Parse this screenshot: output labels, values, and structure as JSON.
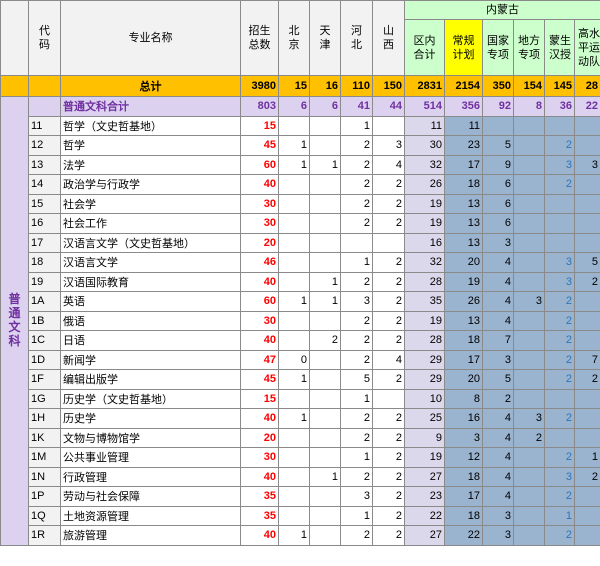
{
  "headers": {
    "code": "代码",
    "name": "专业名称",
    "total_plan": "招生总数",
    "beijing": "北京",
    "tianjin": "天津",
    "hebei": "河北",
    "shanxi": "山西",
    "neimenggu": "内蒙古",
    "qu_nei": "区内合计",
    "changgui": "常规计划",
    "guojia": "国家专项",
    "difang": "地方专项",
    "mengsheng": "蒙生汉授",
    "gaoshui": "高水平运动队"
  },
  "total_row": {
    "label": "总计",
    "values": [
      "3980",
      "15",
      "16",
      "110",
      "150",
      "2831",
      "2154",
      "350",
      "154",
      "145",
      "28"
    ]
  },
  "group": {
    "label": "普通文科",
    "subtotal_label": "普通文科合计",
    "subtotal_values": [
      "803",
      "6",
      "6",
      "41",
      "44",
      "514",
      "356",
      "92",
      "8",
      "36",
      "22"
    ]
  },
  "rows": [
    {
      "code": "11",
      "name": "哲学（文史哲基地）",
      "v": [
        "15",
        "",
        "",
        "1",
        "",
        "11",
        "11",
        "",
        "",
        "",
        ""
      ]
    },
    {
      "code": "12",
      "name": "哲学",
      "v": [
        "45",
        "1",
        "",
        "2",
        "3",
        "30",
        "23",
        "5",
        "",
        "2",
        ""
      ]
    },
    {
      "code": "13",
      "name": "法学",
      "v": [
        "60",
        "1",
        "1",
        "2",
        "4",
        "32",
        "17",
        "9",
        "",
        "3",
        "3"
      ]
    },
    {
      "code": "14",
      "name": "政治学与行政学",
      "v": [
        "40",
        "",
        "",
        "2",
        "2",
        "26",
        "18",
        "6",
        "",
        "2",
        ""
      ]
    },
    {
      "code": "15",
      "name": "社会学",
      "v": [
        "30",
        "",
        "",
        "2",
        "2",
        "19",
        "13",
        "6",
        "",
        "",
        ""
      ]
    },
    {
      "code": "16",
      "name": "社会工作",
      "v": [
        "30",
        "",
        "",
        "2",
        "2",
        "19",
        "13",
        "6",
        "",
        "",
        ""
      ]
    },
    {
      "code": "17",
      "name": "汉语言文学（文史哲基地）",
      "v": [
        "20",
        "",
        "",
        "",
        "",
        "16",
        "13",
        "3",
        "",
        "",
        ""
      ]
    },
    {
      "code": "18",
      "name": "汉语言文学",
      "v": [
        "46",
        "",
        "",
        "1",
        "2",
        "32",
        "20",
        "4",
        "",
        "3",
        "5"
      ]
    },
    {
      "code": "19",
      "name": "汉语国际教育",
      "v": [
        "40",
        "",
        "1",
        "2",
        "2",
        "28",
        "19",
        "4",
        "",
        "3",
        "2"
      ]
    },
    {
      "code": "1A",
      "name": "英语",
      "v": [
        "60",
        "1",
        "1",
        "3",
        "2",
        "35",
        "26",
        "4",
        "3",
        "2",
        ""
      ]
    },
    {
      "code": "1B",
      "name": "俄语",
      "v": [
        "30",
        "",
        "",
        "2",
        "2",
        "19",
        "13",
        "4",
        "",
        "2",
        ""
      ]
    },
    {
      "code": "1C",
      "name": "日语",
      "v": [
        "40",
        "",
        "2",
        "2",
        "2",
        "28",
        "18",
        "7",
        "",
        "2",
        ""
      ]
    },
    {
      "code": "1D",
      "name": "新闻学",
      "v": [
        "47",
        "0",
        "",
        "2",
        "4",
        "29",
        "17",
        "3",
        "",
        "2",
        "7"
      ]
    },
    {
      "code": "1F",
      "name": "编辑出版学",
      "v": [
        "45",
        "1",
        "",
        "5",
        "2",
        "29",
        "20",
        "5",
        "",
        "2",
        "2"
      ]
    },
    {
      "code": "1G",
      "name": "历史学（文史哲基地）",
      "v": [
        "15",
        "",
        "",
        "1",
        "",
        "10",
        "8",
        "2",
        "",
        "",
        ""
      ]
    },
    {
      "code": "1H",
      "name": "历史学",
      "v": [
        "40",
        "1",
        "",
        "2",
        "2",
        "25",
        "16",
        "4",
        "3",
        "2",
        ""
      ]
    },
    {
      "code": "1K",
      "name": "文物与博物馆学",
      "v": [
        "20",
        "",
        "",
        "2",
        "2",
        "9",
        "3",
        "4",
        "2",
        "",
        ""
      ]
    },
    {
      "code": "1M",
      "name": "公共事业管理",
      "v": [
        "30",
        "",
        "",
        "1",
        "2",
        "19",
        "12",
        "4",
        "",
        "2",
        "1"
      ]
    },
    {
      "code": "1N",
      "name": "行政管理",
      "v": [
        "40",
        "",
        "1",
        "2",
        "2",
        "27",
        "18",
        "4",
        "",
        "3",
        "2"
      ]
    },
    {
      "code": "1P",
      "name": "劳动与社会保障",
      "v": [
        "35",
        "",
        "",
        "3",
        "2",
        "23",
        "17",
        "4",
        "",
        "2",
        ""
      ]
    },
    {
      "code": "1Q",
      "name": "土地资源管理",
      "v": [
        "35",
        "",
        "",
        "1",
        "2",
        "22",
        "18",
        "3",
        "",
        "1",
        ""
      ]
    },
    {
      "code": "1R",
      "name": "旅游管理",
      "v": [
        "40",
        "1",
        "",
        "2",
        "2",
        "27",
        "22",
        "3",
        "",
        "2",
        ""
      ]
    }
  ]
}
